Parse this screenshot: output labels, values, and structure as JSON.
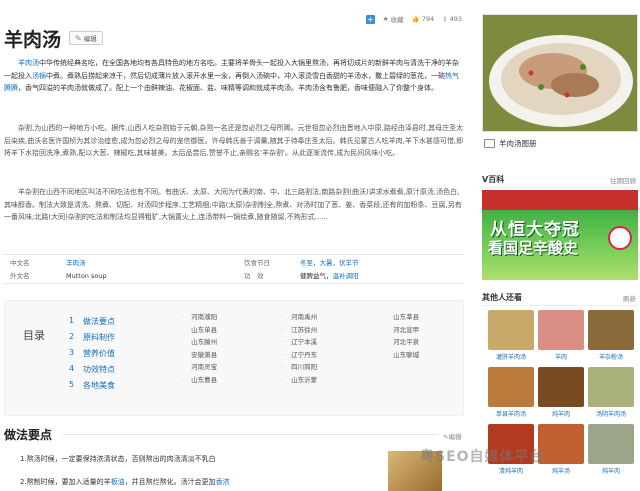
{
  "header": {
    "title": "羊肉汤",
    "edit_label": "编辑",
    "fav_label": "收藏",
    "likes": "794",
    "shares": "493"
  },
  "paragraphs": {
    "p1_a": "羊肉汤",
    "p1_b": "中华传统经典名吃，在全国各地均有各具特色的地方名吃。主要将羊骨头一起投入大锅里熬汤，再将切成片的新鲜羊肉与清洗干净的羊杂一起投入",
    "p1_c": "汤锅",
    "p1_d": "中煮。煮熟后捞起来凉干，然后切成薄片放入滚开水里一汆，再倒入汤碗中，冲入滚烫雪白香甜的羊汤水，撒上碧绿的葱花，一碗",
    "p1_e": "热气腾腾",
    "p1_f": "，香气四溢的羊肉汤就做成了。配上一个由鲜辣油、花椒面、盐、味精等调和就成羊肉汤。羊肉汤含有鲁肥，香味便融入了你整个身体。",
    "p2": "杂割,为山西的一种地方小吃。据传,山西人吃杂割始于元朝,杂割一名还是忽必烈之母所赐。元世祖忽必烈由晋地入中原,路经由泽县时,其母庄圣太后染疾,曲沃名医许国桢为其诊治痊愈,成为忽必烈之母的宠信御医。许母韩氏善于调羹,随其于待奉庄圣太后。韩氏见蒙古人吃羊肉,羊下水甚感可惜,即将羊下水拾回洗净,煮熟,配以大葱、辣椒吃,其味甚美。太后品尝后,赞誉不止,亲赐名'羊杂割'。从此逐渐流传,成为民间风味小吃。",
    "p3": "羊杂割在山西不同地区叫法不同吃法也有不同。有曲沃、太原、大同为代表的南、中、北三路割法,南路杂割(曲沃)讲求水煮煮,原汁原汤,汤色白,其味醇香。制法大致是清洗、熬煮、切配、对汤四步程序,工艺精细;中路(太原)杂割制全,熬煮、对汤时加了葱、姜、香菜段,还有的加粉条、豆腐,另有一番风味;北路(大同)杂割的吃法和制法均显得粗犷,大锅置火上,连汤带料一锅烩煮,随食随留,不拘形式......"
  },
  "infobox": {
    "k_cn": "中文名",
    "v_cn": "羊肉汤",
    "k_en": "外文名",
    "v_en": "Mutton soup",
    "k_fest": "饮食节日",
    "v_fest": "冬至，大暑，伏羊节",
    "k_func": "功　效",
    "v_func_a": "健脾益气，",
    "v_func_b": "温补调阳"
  },
  "toc": {
    "title": "目录",
    "items": [
      "做法要点",
      "原料制作",
      "营养价值",
      "功效特点",
      "各地美食"
    ],
    "col1": [
      "河南濮阳",
      "山东单县",
      "山东滕州",
      "安徽萧县",
      "河南灵宝",
      "山东曹县"
    ],
    "col2": [
      "河南禹州",
      "江苏徐州",
      "辽宁本溪",
      "辽宁丹东",
      "四川简阳",
      "山东沂蒙"
    ],
    "col3": [
      "山东莘县",
      "河北宣甲",
      "河北平泉",
      "山东聊城"
    ]
  },
  "section": {
    "title": "做法要点",
    "edit": "编辑",
    "step1": "1.熬汤时候，一定要保持浓清状态，否则熬出的肉汤清淡不乳白",
    "step2_a": "2.熬制时候，要加入适量的羊",
    "step2_b": "板油",
    "step2_c": "，并且熬烂熬化。汤汁会更加",
    "step2_d": "香浓"
  },
  "sidebar": {
    "album": "羊肉汤图册",
    "baike": "V百科",
    "baike_more": "往期回顾",
    "ad_line1": "从恒大夺冠",
    "ad_line2": "看国足辛酸史",
    "others": "其他人还看",
    "others_more": "刷新",
    "items": [
      {
        "label": "灌肝羊肉汤",
        "color": "#c9a86a"
      },
      {
        "label": "羊肉",
        "color": "#d98f86"
      },
      {
        "label": "羊杂粉汤",
        "color": "#8a6a3a"
      },
      {
        "label": "单县羊肉汤",
        "color": "#b97a3c"
      },
      {
        "label": "炖羊肉",
        "color": "#7a4a22"
      },
      {
        "label": "汤阴羊肉汤",
        "color": "#a9b07a"
      },
      {
        "label": "清炖羊肉",
        "color": "#b23a1f"
      },
      {
        "label": "炖羊汤",
        "color": "#c06030"
      },
      {
        "label": "炖羊肉",
        "color": "#9aa58a"
      }
    ]
  },
  "watermark": "粤SEO自媒体平台"
}
